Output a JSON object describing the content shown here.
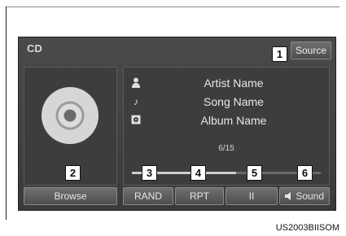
{
  "screen": {
    "title": "CD",
    "source_label": "Source"
  },
  "track_info": {
    "artist": "Artist Name",
    "song": "Song Name",
    "album": "Album Name",
    "track_count": "6/15",
    "artist_icon": "person-icon",
    "song_icon": "music-note-icon",
    "album_icon": "album-icon"
  },
  "progress": {
    "fraction": 0.55
  },
  "buttons": {
    "browse": "Browse",
    "rand": "RAND",
    "rpt": "RPT",
    "pause": "II",
    "sound": "Sound",
    "sound_icon": "speaker-icon"
  },
  "callouts": [
    "1",
    "2",
    "3",
    "4",
    "5",
    "6"
  ],
  "image_code": "US2003BIISOM"
}
